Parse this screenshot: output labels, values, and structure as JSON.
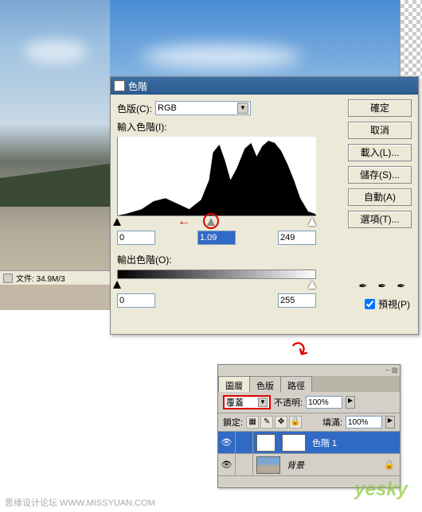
{
  "dialog": {
    "title": "色階",
    "channel_label": "色版(C):",
    "channel_value": "RGB",
    "input_label": "輸入色階(I):",
    "output_label": "輸出色階(O):",
    "input_black": "0",
    "input_gamma": "1.09",
    "input_white": "249",
    "output_black": "0",
    "output_white": "255",
    "buttons": {
      "ok": "確定",
      "cancel": "取消",
      "load": "載入(L)...",
      "save": "儲存(S)...",
      "auto": "自動(A)",
      "options": "選項(T)..."
    },
    "preview_label": "預視(P)"
  },
  "statusbar": {
    "text": "文件: 34.9M/3"
  },
  "layers": {
    "tabs": {
      "layers": "圖層",
      "channels": "色版",
      "paths": "路徑"
    },
    "blend_mode": "覆蓋",
    "opacity_label": "不透明:",
    "opacity_value": "100%",
    "lock_label": "鎖定:",
    "fill_label": "填滿:",
    "fill_value": "100%",
    "items": [
      {
        "name": "色階 1"
      },
      {
        "name": "背景"
      }
    ]
  },
  "footer": {
    "text": "思缘设计论坛   WWW.MISSYUAN.COM"
  },
  "watermark": "yesky"
}
